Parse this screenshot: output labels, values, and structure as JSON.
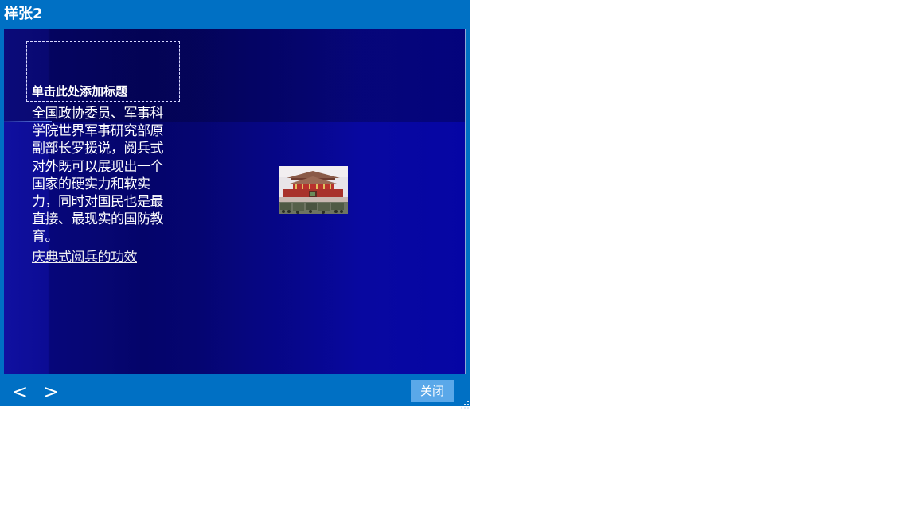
{
  "window": {
    "title": "样张2"
  },
  "slide": {
    "title_placeholder": "单击此处添加标题",
    "body_text": "全国政协委员、军事科学院世界军事研究部原副部长罗援说，阅兵式对外既可以展现出一个国家的硬实力和软实力，同时对国民也是最直接、最现实的国防教育。",
    "link_text": "庆典式阅兵的功效",
    "image": "tiananmen-parade-photo"
  },
  "controls": {
    "prev_label": "<",
    "next_label": ">",
    "close_label": "关闭"
  },
  "colors": {
    "window_blue": "#0070c4",
    "slide_blue": "#0505a4",
    "close_button": "#5aa8e9"
  }
}
